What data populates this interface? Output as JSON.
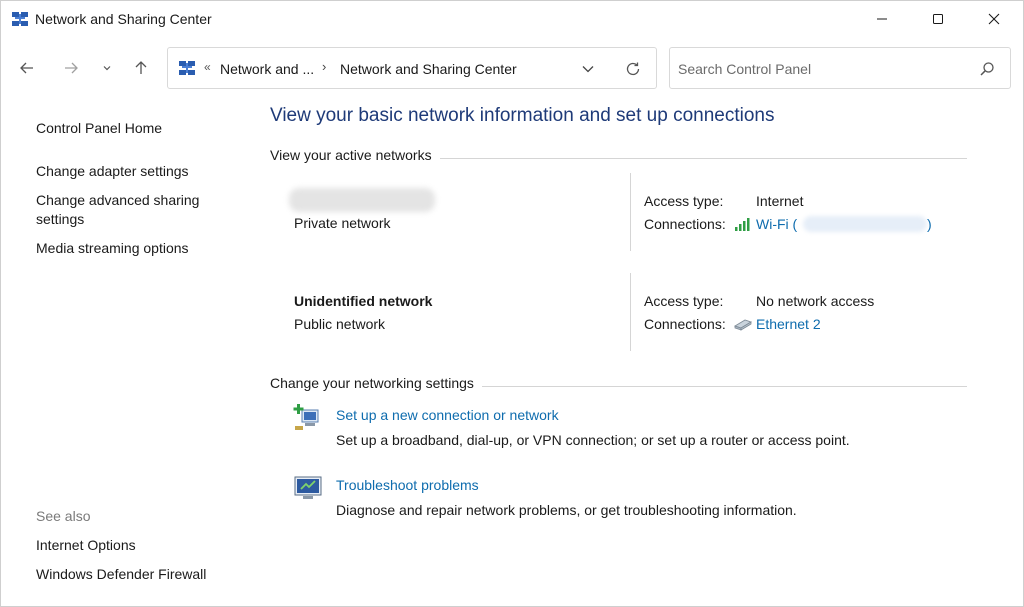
{
  "window": {
    "title": "Network and Sharing Center",
    "accent": "#1e3a78",
    "link_color": "#0e6cae"
  },
  "icons": {
    "app": "network-center-icon",
    "minimize": "minimize-icon",
    "maximize": "maximize-icon",
    "close": "close-icon",
    "back": "arrow-left-icon",
    "forward": "arrow-right-icon",
    "recent": "chevron-down-icon",
    "up": "arrow-up-icon",
    "refresh": "refresh-icon",
    "search": "search-icon"
  },
  "address": {
    "chevrons": "«",
    "crumb1": "Network and ...",
    "separator": "›",
    "crumb2": "Network and Sharing Center"
  },
  "search": {
    "placeholder": "Search Control Panel",
    "value": ""
  },
  "sidebar": {
    "home": "Control Panel Home",
    "items": [
      "Change adapter settings",
      "Change advanced sharing settings",
      "Media streaming options"
    ],
    "see_also_label": "See also",
    "see_also": [
      "Internet Options",
      "Windows Defender Firewall"
    ]
  },
  "main": {
    "title": "View your basic network information and set up connections",
    "active_networks_heading": "View your active networks",
    "networks": [
      {
        "name": "",
        "category": "Private network",
        "access_label": "Access type:",
        "access_value": "Internet",
        "connections_label": "Connections:",
        "connection_name": "Wi-Fi (",
        "connection_suffix": ")"
      },
      {
        "name": "Unidentified network",
        "category": "Public network",
        "access_label": "Access type:",
        "access_value": "No network access",
        "connections_label": "Connections:",
        "connection_name": "Ethernet 2"
      }
    ],
    "settings_heading": "Change your networking settings",
    "tasks": [
      {
        "icon": "new-connection-icon",
        "link": "Set up a new connection or network",
        "description": "Set up a broadband, dial-up, or VPN connection; or set up a router or access point."
      },
      {
        "icon": "troubleshoot-icon",
        "link": "Troubleshoot problems",
        "description": "Diagnose and repair network problems, or get troubleshooting information."
      }
    ]
  }
}
